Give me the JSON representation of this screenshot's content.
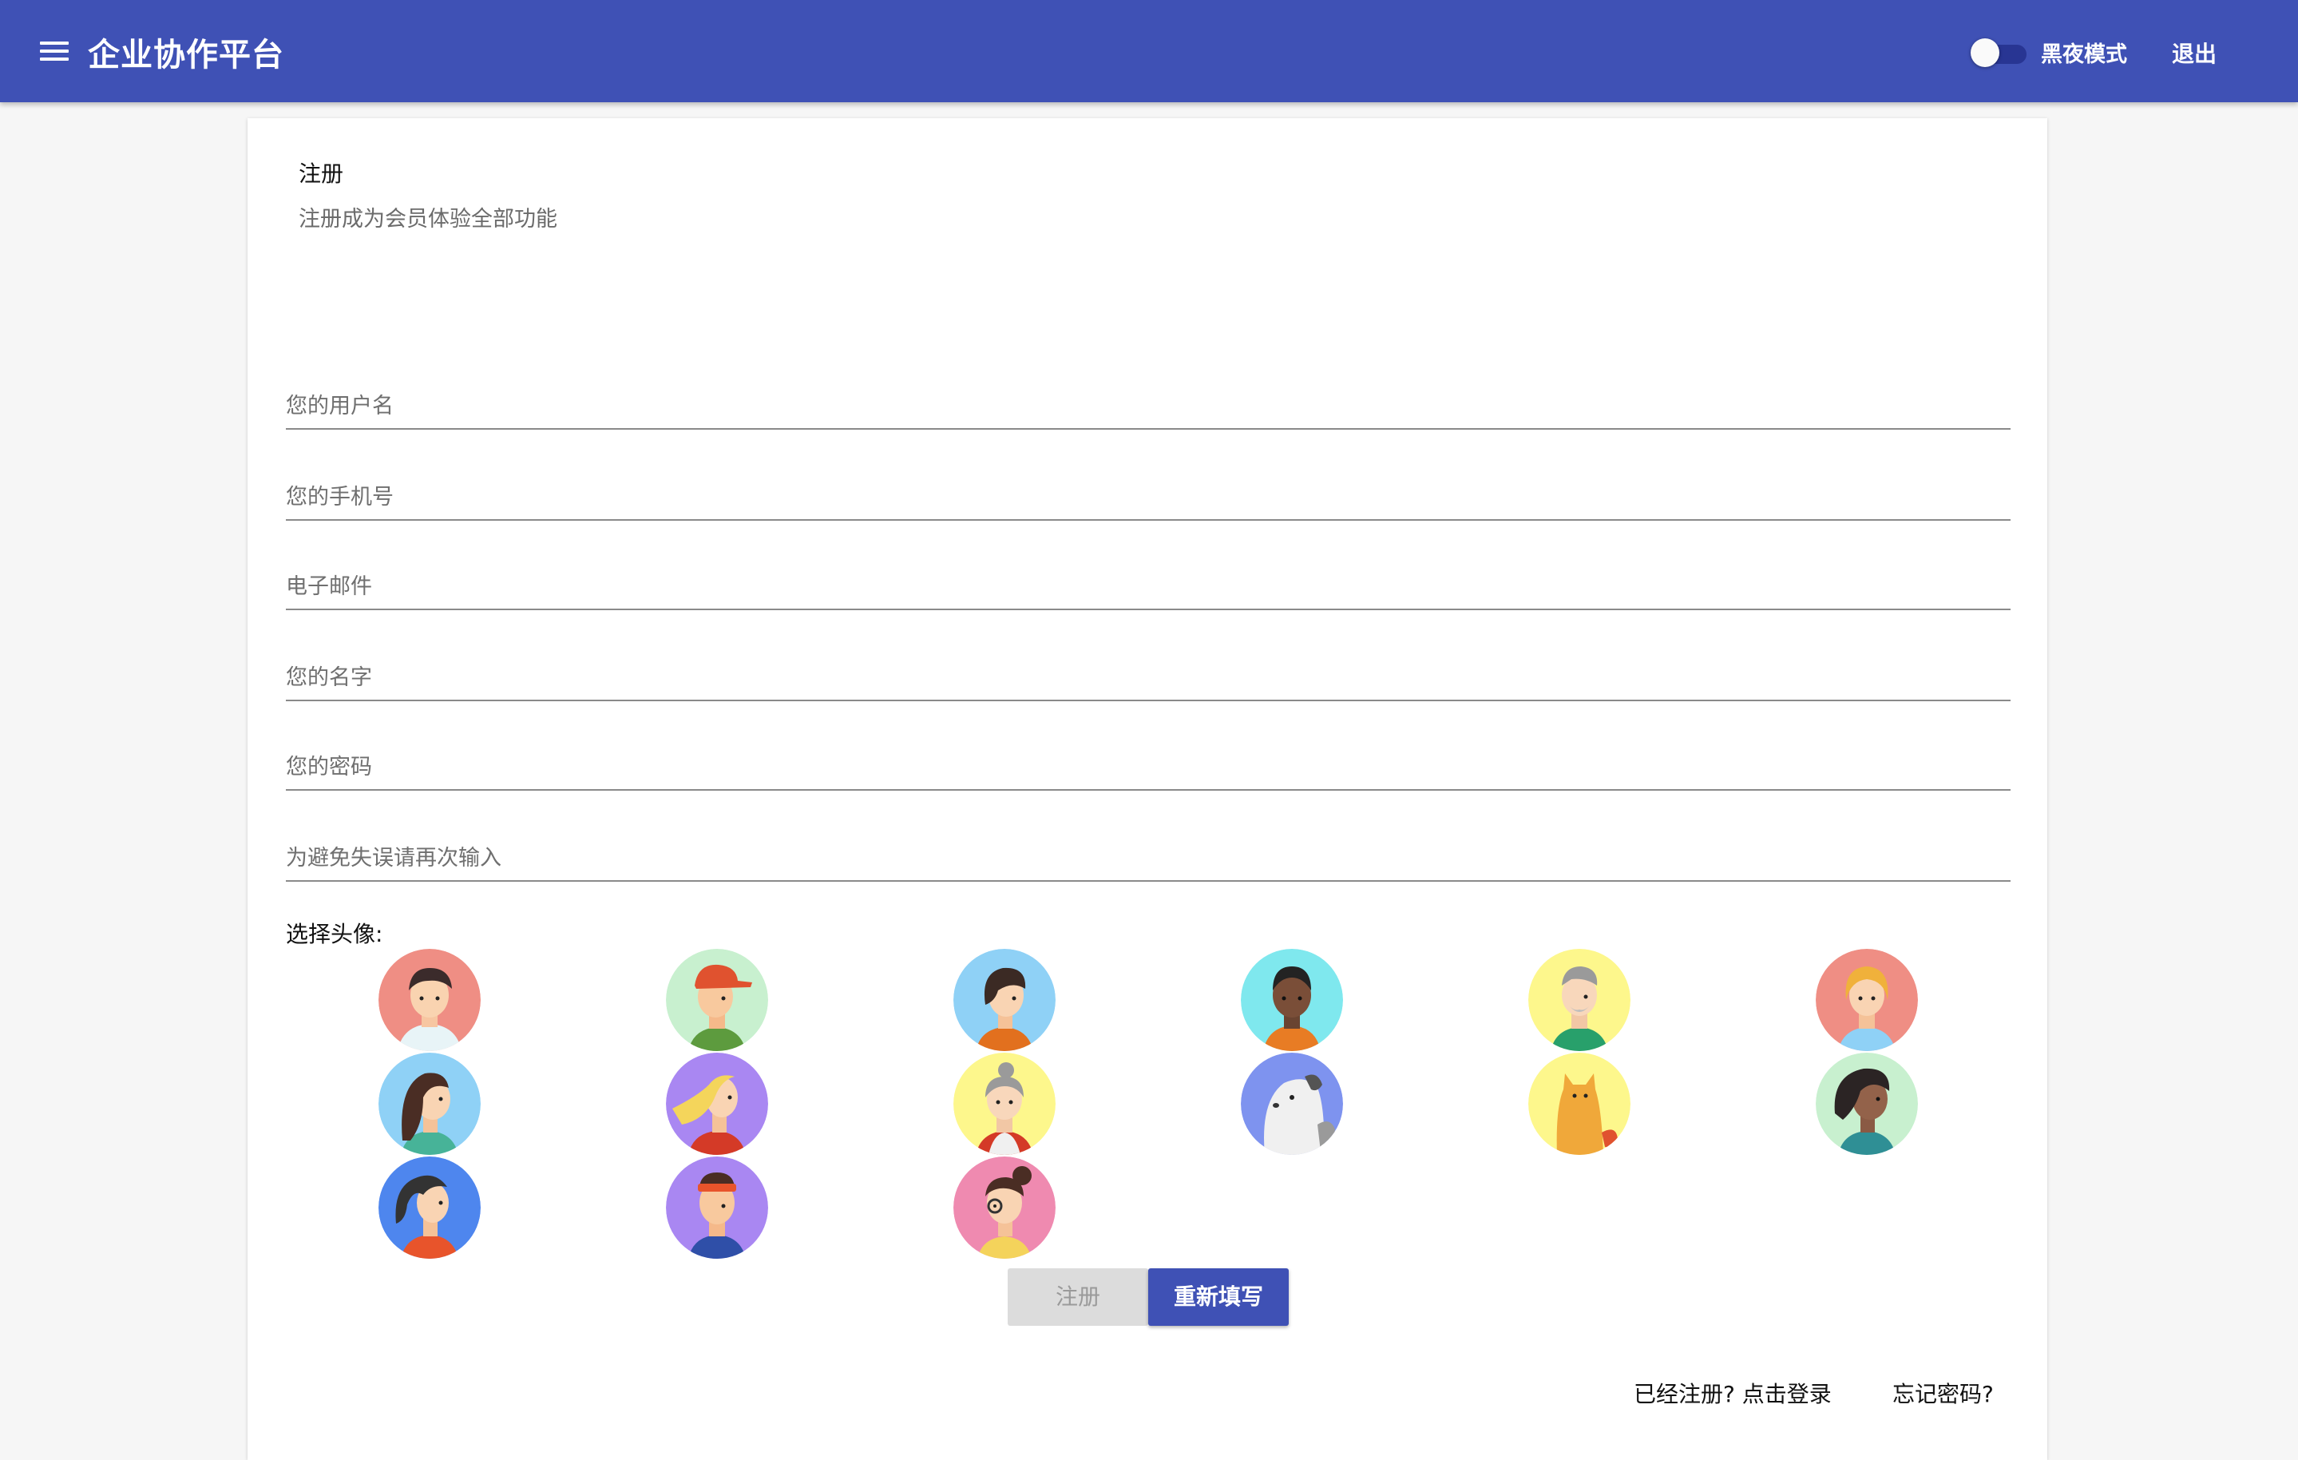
{
  "header": {
    "menu_icon": "hamburger-menu-icon",
    "title": "企业协作平台",
    "dark_mode_label": "黑夜模式",
    "dark_mode_on": false,
    "logout_label": "退出",
    "bar_color": "#3f51b5"
  },
  "card": {
    "title": "注册",
    "subtitle": "注册成为会员体验全部功能"
  },
  "fields": [
    {
      "placeholder": "您的用户名",
      "value": ""
    },
    {
      "placeholder": "您的手机号",
      "value": ""
    },
    {
      "placeholder": "电子邮件",
      "value": ""
    },
    {
      "placeholder": "您的名字",
      "value": ""
    },
    {
      "placeholder": "您的密码",
      "value": ""
    },
    {
      "placeholder": "为避免失误请再次输入",
      "value": ""
    }
  ],
  "avatars": {
    "label": "选择头像:",
    "items": [
      {
        "name": "avatar-boy-icon",
        "bg": "#ef8e84"
      },
      {
        "name": "avatar-cap-boy-icon",
        "bg": "#c8f0cf"
      },
      {
        "name": "avatar-girl-short-hair-icon",
        "bg": "#8fd1f6"
      },
      {
        "name": "avatar-dark-skin-man-icon",
        "bg": "#7fe8ee"
      },
      {
        "name": "avatar-old-man-icon",
        "bg": "#fdf78c"
      },
      {
        "name": "avatar-blonde-girl-icon",
        "bg": "#ef8e84"
      },
      {
        "name": "avatar-long-hair-woman-icon",
        "bg": "#8fd1f6"
      },
      {
        "name": "avatar-blonde-woman-icon",
        "bg": "#a987f2"
      },
      {
        "name": "avatar-grandma-icon",
        "bg": "#fdf78c"
      },
      {
        "name": "avatar-dog-icon",
        "bg": "#7e93ef"
      },
      {
        "name": "avatar-cat-icon",
        "bg": "#fdf78c"
      },
      {
        "name": "avatar-curly-woman-icon",
        "bg": "#c8f0cf"
      },
      {
        "name": "avatar-ponytail-girl-icon",
        "bg": "#4e86ee"
      },
      {
        "name": "avatar-headband-man-icon",
        "bg": "#a987f2"
      },
      {
        "name": "avatar-glasses-girl-icon",
        "bg": "#ef8ab0"
      }
    ]
  },
  "buttons": {
    "register_label": "注册",
    "reset_label": "重新填写"
  },
  "links": {
    "login_label": "已经注册? 点击登录",
    "forgot_label": "忘记密码?"
  }
}
